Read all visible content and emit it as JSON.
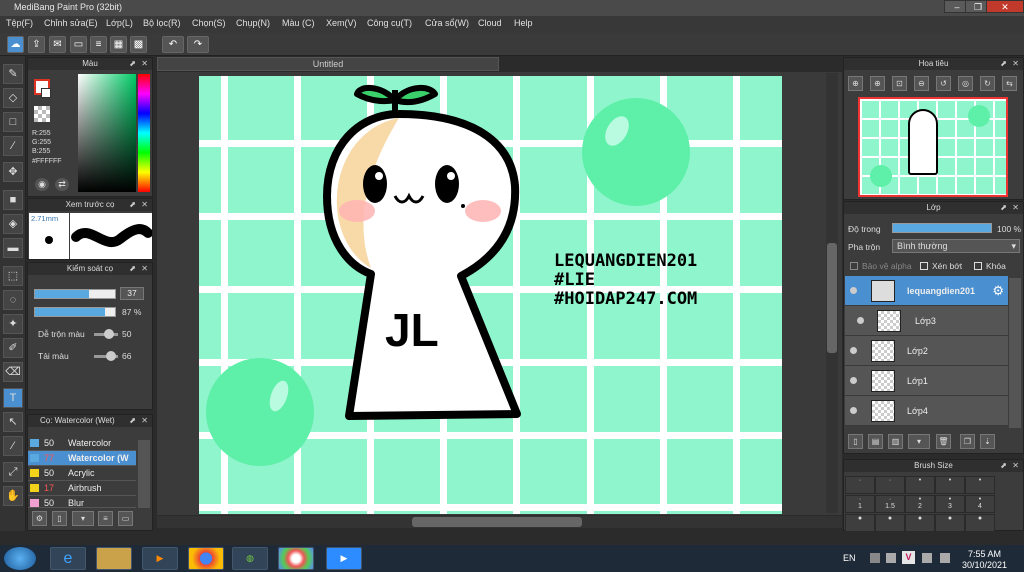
{
  "window": {
    "title": "MediBang Paint Pro (32bit)"
  },
  "menu": [
    "Tệp(F)",
    "Chỉnh sửa(E)",
    "Lớp(L)",
    "Bộ lọc(R)",
    "Chọn(S)",
    "Chụp(N)",
    "Màu (C)",
    "Xem(V)",
    "Công cụ(T)",
    "Cửa sổ(W)",
    "Cloud",
    "Help"
  ],
  "panels": {
    "color": {
      "title": "Màu",
      "r": "R:255",
      "g": "G:255",
      "b": "B:255",
      "hex": "#FFFFFF"
    },
    "preview": {
      "title": "Xem trước cọ",
      "size": "2.71mm"
    },
    "control": {
      "title": "Kiểm soát cọ",
      "size_value": "37",
      "opacity_value": "87 %",
      "blend_label": "Dễ trộn màu",
      "blend_value": "50",
      "load_label": "Tải màu",
      "load_value": "66"
    },
    "brushes": {
      "title": "Cọ: Watercolor (Wet)",
      "rows": [
        {
          "value": "50",
          "name": "Watercolor",
          "color": "#5aa8e0"
        },
        {
          "value": "77",
          "name": "Watercolor (W",
          "color": "#5aa8e0",
          "selected": true
        },
        {
          "value": "50",
          "name": "Acrylic",
          "color": "#f2d21a"
        },
        {
          "value": "17",
          "name": "Airbrush",
          "color": "#f2d21a"
        },
        {
          "value": "50",
          "name": "Blur",
          "color": "#f0a0d0"
        }
      ]
    },
    "navigator": {
      "title": "Hoa tiêu"
    },
    "layers": {
      "title": "Lớp",
      "opacity_label": "Độ trong",
      "opacity_value": "100 %",
      "opacity_fraction": 1.0,
      "blend_label": "Pha trộn",
      "blend_value": "Bình thường",
      "protect_alpha": "Bảo vệ alpha",
      "clip": "Xén bớt",
      "lock": "Khóa",
      "items": [
        {
          "name": "lequangdien201",
          "selected": true
        },
        {
          "name": "Lớp3"
        },
        {
          "name": "Lớp2"
        },
        {
          "name": "Lớp1"
        },
        {
          "name": "Lớp4"
        }
      ]
    },
    "brush_size": {
      "title": "Brush Size",
      "labels": [
        "1",
        "1.5",
        "2",
        "3",
        "4"
      ]
    }
  },
  "document": {
    "tab": "Untitled"
  },
  "artwork": {
    "line1": "LEQUANGDIEN201",
    "line2": "#LIE",
    "line3": "#HOIDAP247.COM",
    "body_text": "JL"
  },
  "taskbar": {
    "lang": "EN",
    "time": "7:55 AM",
    "date": "30/10/2021"
  },
  "colors": {
    "canvas_bg": "#8ff5cc",
    "accent": "#5aa8e0",
    "bubble": "#5ef0a8"
  }
}
